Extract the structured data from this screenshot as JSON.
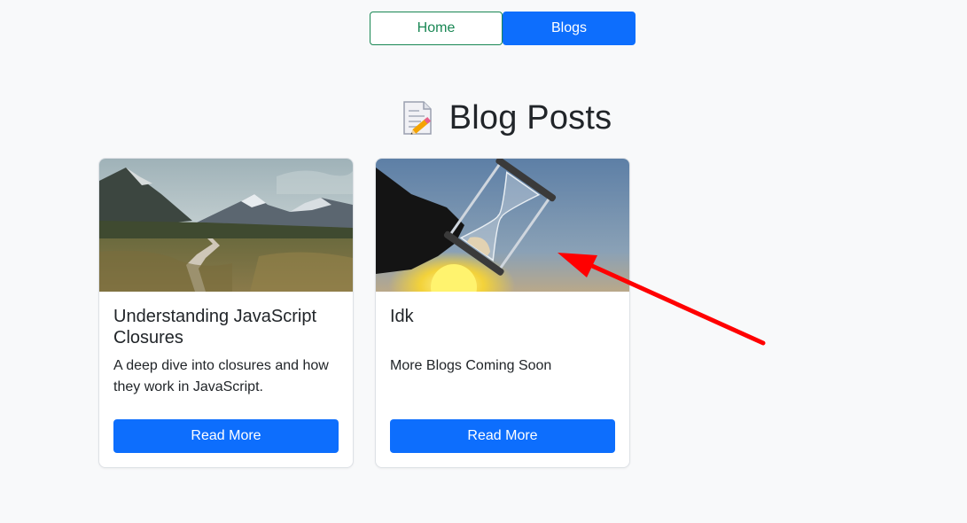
{
  "nav": {
    "home_label": "Home",
    "blogs_label": "Blogs"
  },
  "page": {
    "heading": "Blog Posts",
    "heading_icon": "memo-icon"
  },
  "posts": [
    {
      "title": "Understanding JavaScript Closures",
      "description": "A deep dive into closures and how they work in JavaScript.",
      "button_label": "Read More",
      "image": "mountain-landscape-image"
    },
    {
      "title": "Idk",
      "description": "More Blogs Coming Soon",
      "button_label": "Read More",
      "image": "hourglass-image"
    }
  ],
  "annotation": {
    "type": "red-arrow",
    "color": "#ff0000"
  },
  "colors": {
    "primary": "#0d6efd",
    "success": "#198754",
    "background": "#f8f9fa"
  }
}
